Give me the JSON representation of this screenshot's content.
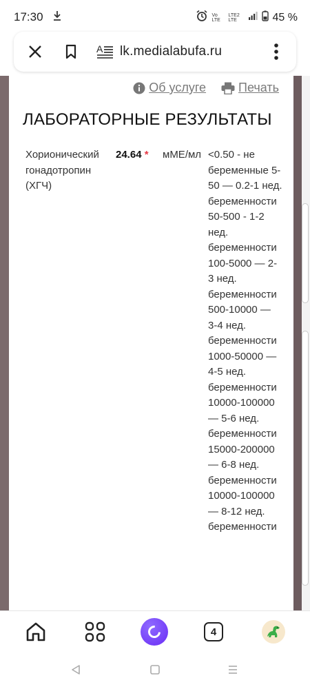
{
  "status_bar": {
    "time": "17:30",
    "battery": "45 %",
    "network_top": "Vo LTE",
    "network_bottom": "LTE2 LTE"
  },
  "browser": {
    "url": "lk.medialabufa.ru",
    "tabs_count": "4"
  },
  "page": {
    "about_link": "Об услуге",
    "print_link": "Печать",
    "heading": "ЛАБОРАТОРНЫЕ РЕЗУЛЬТАТЫ",
    "result": {
      "name": "Хорионический гонадотропин (ХГЧ)",
      "value": "24.64",
      "flag": "*",
      "unit": "мМЕ/мл",
      "reference": "<0.50 - не беременные 5-50 — 0.2-1 нед. беременности 50-500 - 1-2 нед. беременности 100-5000 — 2-3 нед. беременности 500-10000 — 3-4 нед. беременности 1000-50000 — 4-5 нед. беременности 10000-100000 — 5-6 нед. беременности 15000-200000 — 6-8 нед. беременности 10000-100000 — 8-12 нед. беременности"
    }
  },
  "colors": {
    "accent_alice": "#6a2cf5",
    "flag_red": "#e63946",
    "side_panel": "#6d5c5f"
  },
  "icons": [
    "download-icon",
    "alarm-icon",
    "signal-icon",
    "battery-icon",
    "close-icon",
    "bookmark-icon",
    "reader-mode-icon",
    "more-icon",
    "info-icon",
    "printer-icon",
    "home-icon",
    "grid-icon",
    "alice-icon",
    "dino-icon",
    "back-nav-icon",
    "home-nav-icon",
    "recents-nav-icon"
  ]
}
